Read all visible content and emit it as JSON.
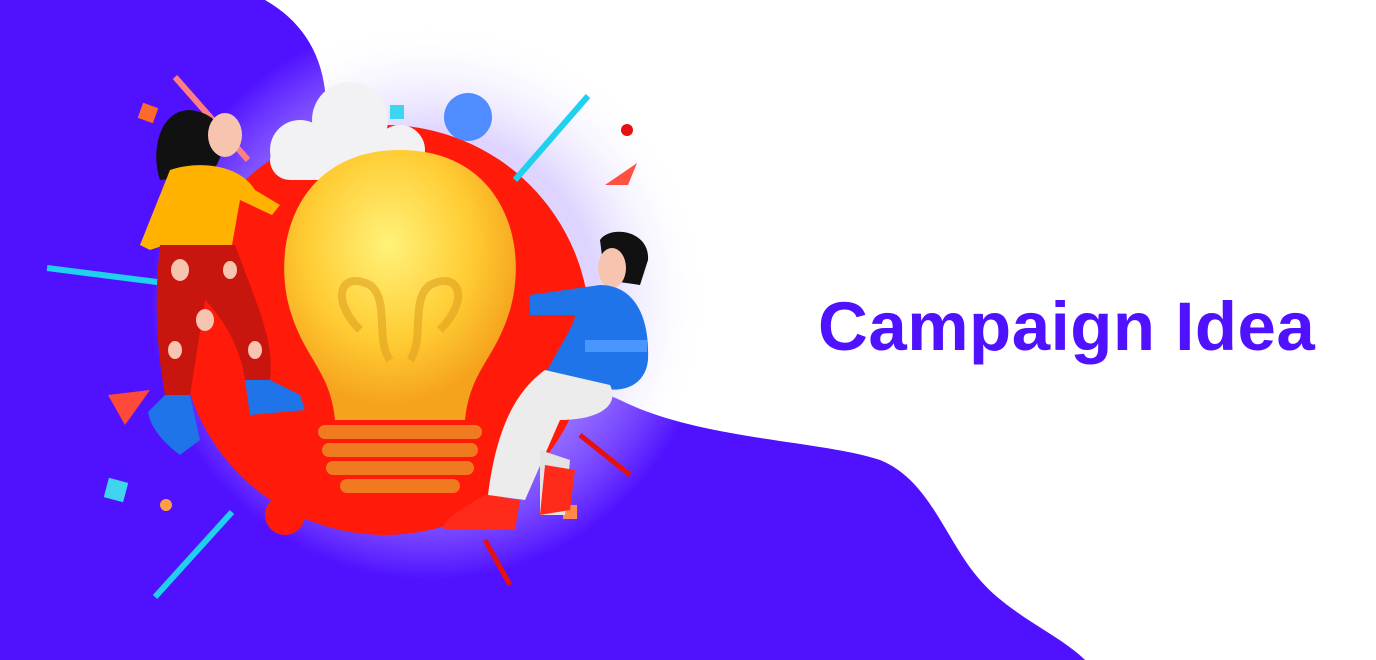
{
  "title": "Campaign Idea",
  "colors": {
    "brand_purple": "#5011ff",
    "circle_red": "#ff1a0a",
    "bulb_yellow": "#ffd23a",
    "background": "#ffffff"
  },
  "illustration": {
    "subject": "idea-lightbulb-with-two-people",
    "icons": [
      "lightbulb-icon",
      "cloud-icon",
      "woman-figure",
      "man-figure"
    ]
  }
}
